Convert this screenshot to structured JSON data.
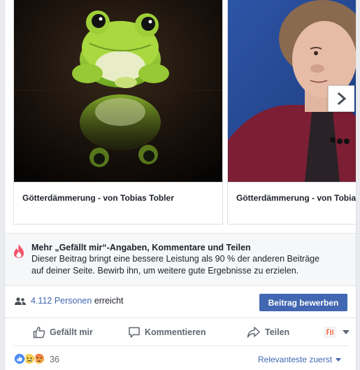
{
  "carousel": {
    "items": [
      {
        "caption": "Götterdämmerung - von Tobias Tobler",
        "image": "frog-photo"
      },
      {
        "caption": "Götterdämmerung - von Tobias Tobler",
        "image": "portrait-photo"
      }
    ],
    "next_icon": "chevron-right-icon"
  },
  "insight": {
    "icon": "flame-icon",
    "title": "Mehr „Gefällt mir“-Angaben, Kommentare und Teilen",
    "line1": "Dieser Beitrag bringt eine bessere Leistung als 90 % der anderen Beiträge",
    "line2": "auf deiner Seite. Bewirb ihn, um weitere gute Ergebnisse zu erzielen."
  },
  "reach": {
    "icon": "people-icon",
    "link_text": "4.112 Personen",
    "suffix": " erreicht",
    "promote_label": "Beitrag bewerben"
  },
  "actions": {
    "like": "Gefällt mir",
    "comment": "Kommentieren",
    "share": "Teilen"
  },
  "reactions": {
    "count": "36",
    "sort_label": "Relevanteste zuerst",
    "types": [
      "like",
      "sad",
      "angry"
    ]
  },
  "colors": {
    "accent": "#4267b2",
    "text": "#1d2129",
    "muted": "#606770",
    "flame": "#f35369"
  }
}
